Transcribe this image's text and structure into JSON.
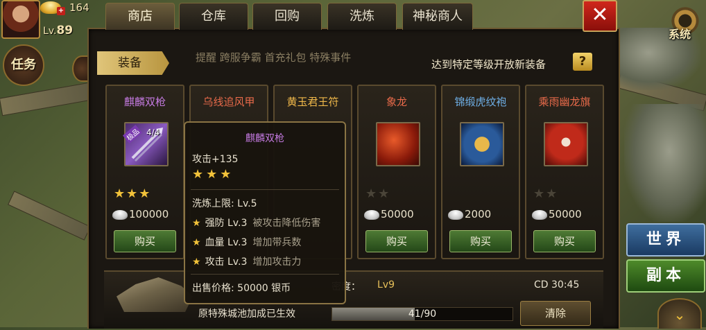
{
  "hud": {
    "gold": "164",
    "level_prefix": "Lv.",
    "level": "89",
    "task_label": "任务",
    "system_label": "系统",
    "faded_text": "提醒 跨服争霸 首充礼包 特殊事件"
  },
  "tabs": [
    "商店",
    "仓库",
    "回购",
    "洗炼",
    "神秘商人"
  ],
  "close_label": "✕",
  "section_tab": "装备",
  "notice": "达到特定等级开放新装备",
  "help_label": "?",
  "items": [
    {
      "name": "麒麟双枪",
      "quality": "purple",
      "badge": "极品",
      "count": "4/4",
      "stars": 3,
      "max_stars": 3,
      "price": "100000",
      "buy": "购买"
    },
    {
      "name": "乌线追风甲",
      "quality": "red",
      "stars": 0,
      "max_stars": 0,
      "price": "",
      "buy": ""
    },
    {
      "name": "黄玉君王符",
      "quality": "orange",
      "stars": 0,
      "max_stars": 0,
      "price": "",
      "buy": ""
    },
    {
      "name": "象龙",
      "quality": "red",
      "stars": 0,
      "max_stars": 2,
      "price": "50000",
      "buy": "购买"
    },
    {
      "name": "锦缎虎纹袍",
      "quality": "blue",
      "stars": 0,
      "max_stars": 0,
      "price": "2000",
      "buy": "购买"
    },
    {
      "name": "乘雨幽龙旗",
      "quality": "red",
      "stars": 0,
      "max_stars": 2,
      "price": "50000",
      "buy": "购买"
    }
  ],
  "tooltip": {
    "title": "麒麟双枪",
    "attack": "攻击+135",
    "stars": 3,
    "refine_limit": "洗炼上限: Lv.5",
    "attrs": [
      {
        "name": "强防 Lv.3",
        "desc": "被攻击降低伤害"
      },
      {
        "name": "血量 Lv.3",
        "desc": "增加带兵数"
      },
      {
        "name": "攻击 Lv.3",
        "desc": "增加攻击力"
      }
    ],
    "sell_price": "出售价格: 50000 银币"
  },
  "bottom": {
    "density_label": "密度：",
    "density_value": "Lv9",
    "cd": "CD 30:45",
    "effect": "原特殊城池加成已生效",
    "progress_text": "41/90",
    "progress_value": 0.456,
    "clear_label": "清除"
  },
  "side": {
    "world": "世界",
    "dungeon": "副本",
    "expand_icon": "chevron-down-icon"
  },
  "colors": {
    "purple": "#c47ae0",
    "red": "#e86a4a",
    "orange": "#f0b84a",
    "blue": "#6fb0e8",
    "star": "#f2c23a",
    "buy_green": "#4e7a34"
  }
}
